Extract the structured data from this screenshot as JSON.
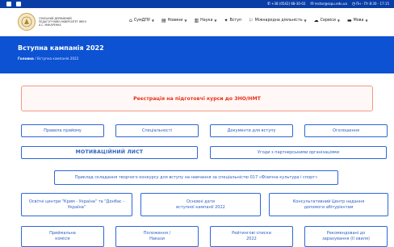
{
  "topbar": {
    "phone": "+38 (0542) 68-30-02",
    "email": "rector@sspu.edu.ua",
    "hours": "Пн - Пт 8:30 - 17:15"
  },
  "header": {
    "logo_text": "СУМСЬКИЙ ДЕРЖАВНИЙ ПЕДАГОГІЧНИЙ УНІВЕРСИТЕТ імені А.С. МАКАРЕНКА",
    "nav": [
      "СумДПУ",
      "Новини",
      "Наука",
      "Вступ",
      "Міжнародна діяльність",
      "Сервіси",
      "Мова"
    ]
  },
  "band": {
    "title": "Вступна кампанія 2022",
    "crumb_home": "Головна",
    "crumb_current": "Вступна кампанія 2022"
  },
  "registration": "Реєстрація на підготовчі курси до ЗНО/НМТ",
  "links": {
    "rules": "Правила прийому",
    "specialties": "Спеціальності",
    "documents": "Документи для вступу",
    "announcements": "Оголошення",
    "motivation_letter": "МОТИВАЦІЙНИЙ ЛИСТ",
    "agreements": "Угоди з партнерськими організаціями",
    "example": "Приклад складання творчого конкурсу для вступу на навчання за спеціальністю 017 «Фізична культура і спорт»",
    "edu_centers": "Освітні центри \"Крим - Україна\" та \"Донбас - Україна\"",
    "key_dates_line1": "Основні дати",
    "key_dates_line2": "вступної кампанії 2022",
    "consult_line1": "Консультативний Центр надання",
    "consult_line2": "допомоги абітурієнтам",
    "commission_line1": "Приймальна",
    "commission_line2": "комісія",
    "regulations_line1": "Положення /",
    "regulations_line2": "Накази",
    "rating_line1": "Рейтингові списки",
    "rating_line2": "2022",
    "recommended_line1": "Рекомендовані до",
    "recommended_line2": "зарахування (ІІ хвиля)"
  },
  "colors": {
    "topbar": "#0a3ea6",
    "band": "#0c52d3",
    "registration_text": "#e6311b",
    "button_border": "#2d67d8",
    "button_text": "#2d5fc4"
  }
}
